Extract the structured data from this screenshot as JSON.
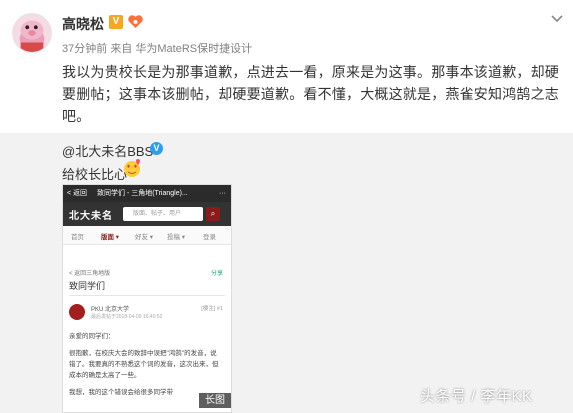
{
  "post": {
    "author": "高晓松",
    "v_badge": "V",
    "meta_time": "37分钟前",
    "meta_from": "来自",
    "meta_device": "华为MateRS保时捷设计",
    "text": "我以为贵校长是为那事道歉，点进去一看，原来是为这事。那事本该道歉，却硬要删帖；这事本该删帖，却硬要道歉。看不懂，大概这就是，燕雀安知鸿鹄之志吧。"
  },
  "repost": {
    "author": "@北大未名BBS",
    "text": "给校长比心",
    "image_tag": "长图",
    "screenshot": {
      "back": "< 返回",
      "page_title": "致同学们 - 三角地(Triangle)...",
      "more": "···",
      "logo": "北大未名",
      "search_placeholder": "版面、帖子、用户",
      "search_icon": "⌕",
      "nav": [
        "首页",
        "版面 ▾",
        "好友 ▾",
        "投稿 ▾",
        "登录"
      ],
      "crumb": "< 返回三角地版",
      "share": "分享",
      "thread_title": "致同学们",
      "user_name": "PKU  北京大学",
      "user_time": "最后发帖于2018-04-09 16:40:52",
      "floor": "[楼主]  #1",
      "body": [
        "亲爱的同学们：",
        "很抱歉，在校庆大会的致辞中误把\"鸿鹄\"的发音，说错了。我要真的不熟悉这个词的发音，这次出来，但成本的确是太高了一些。",
        "我想，我的这个错误会给很多同学带"
      ]
    }
  },
  "watermark": "头条号 / 李年KK"
}
